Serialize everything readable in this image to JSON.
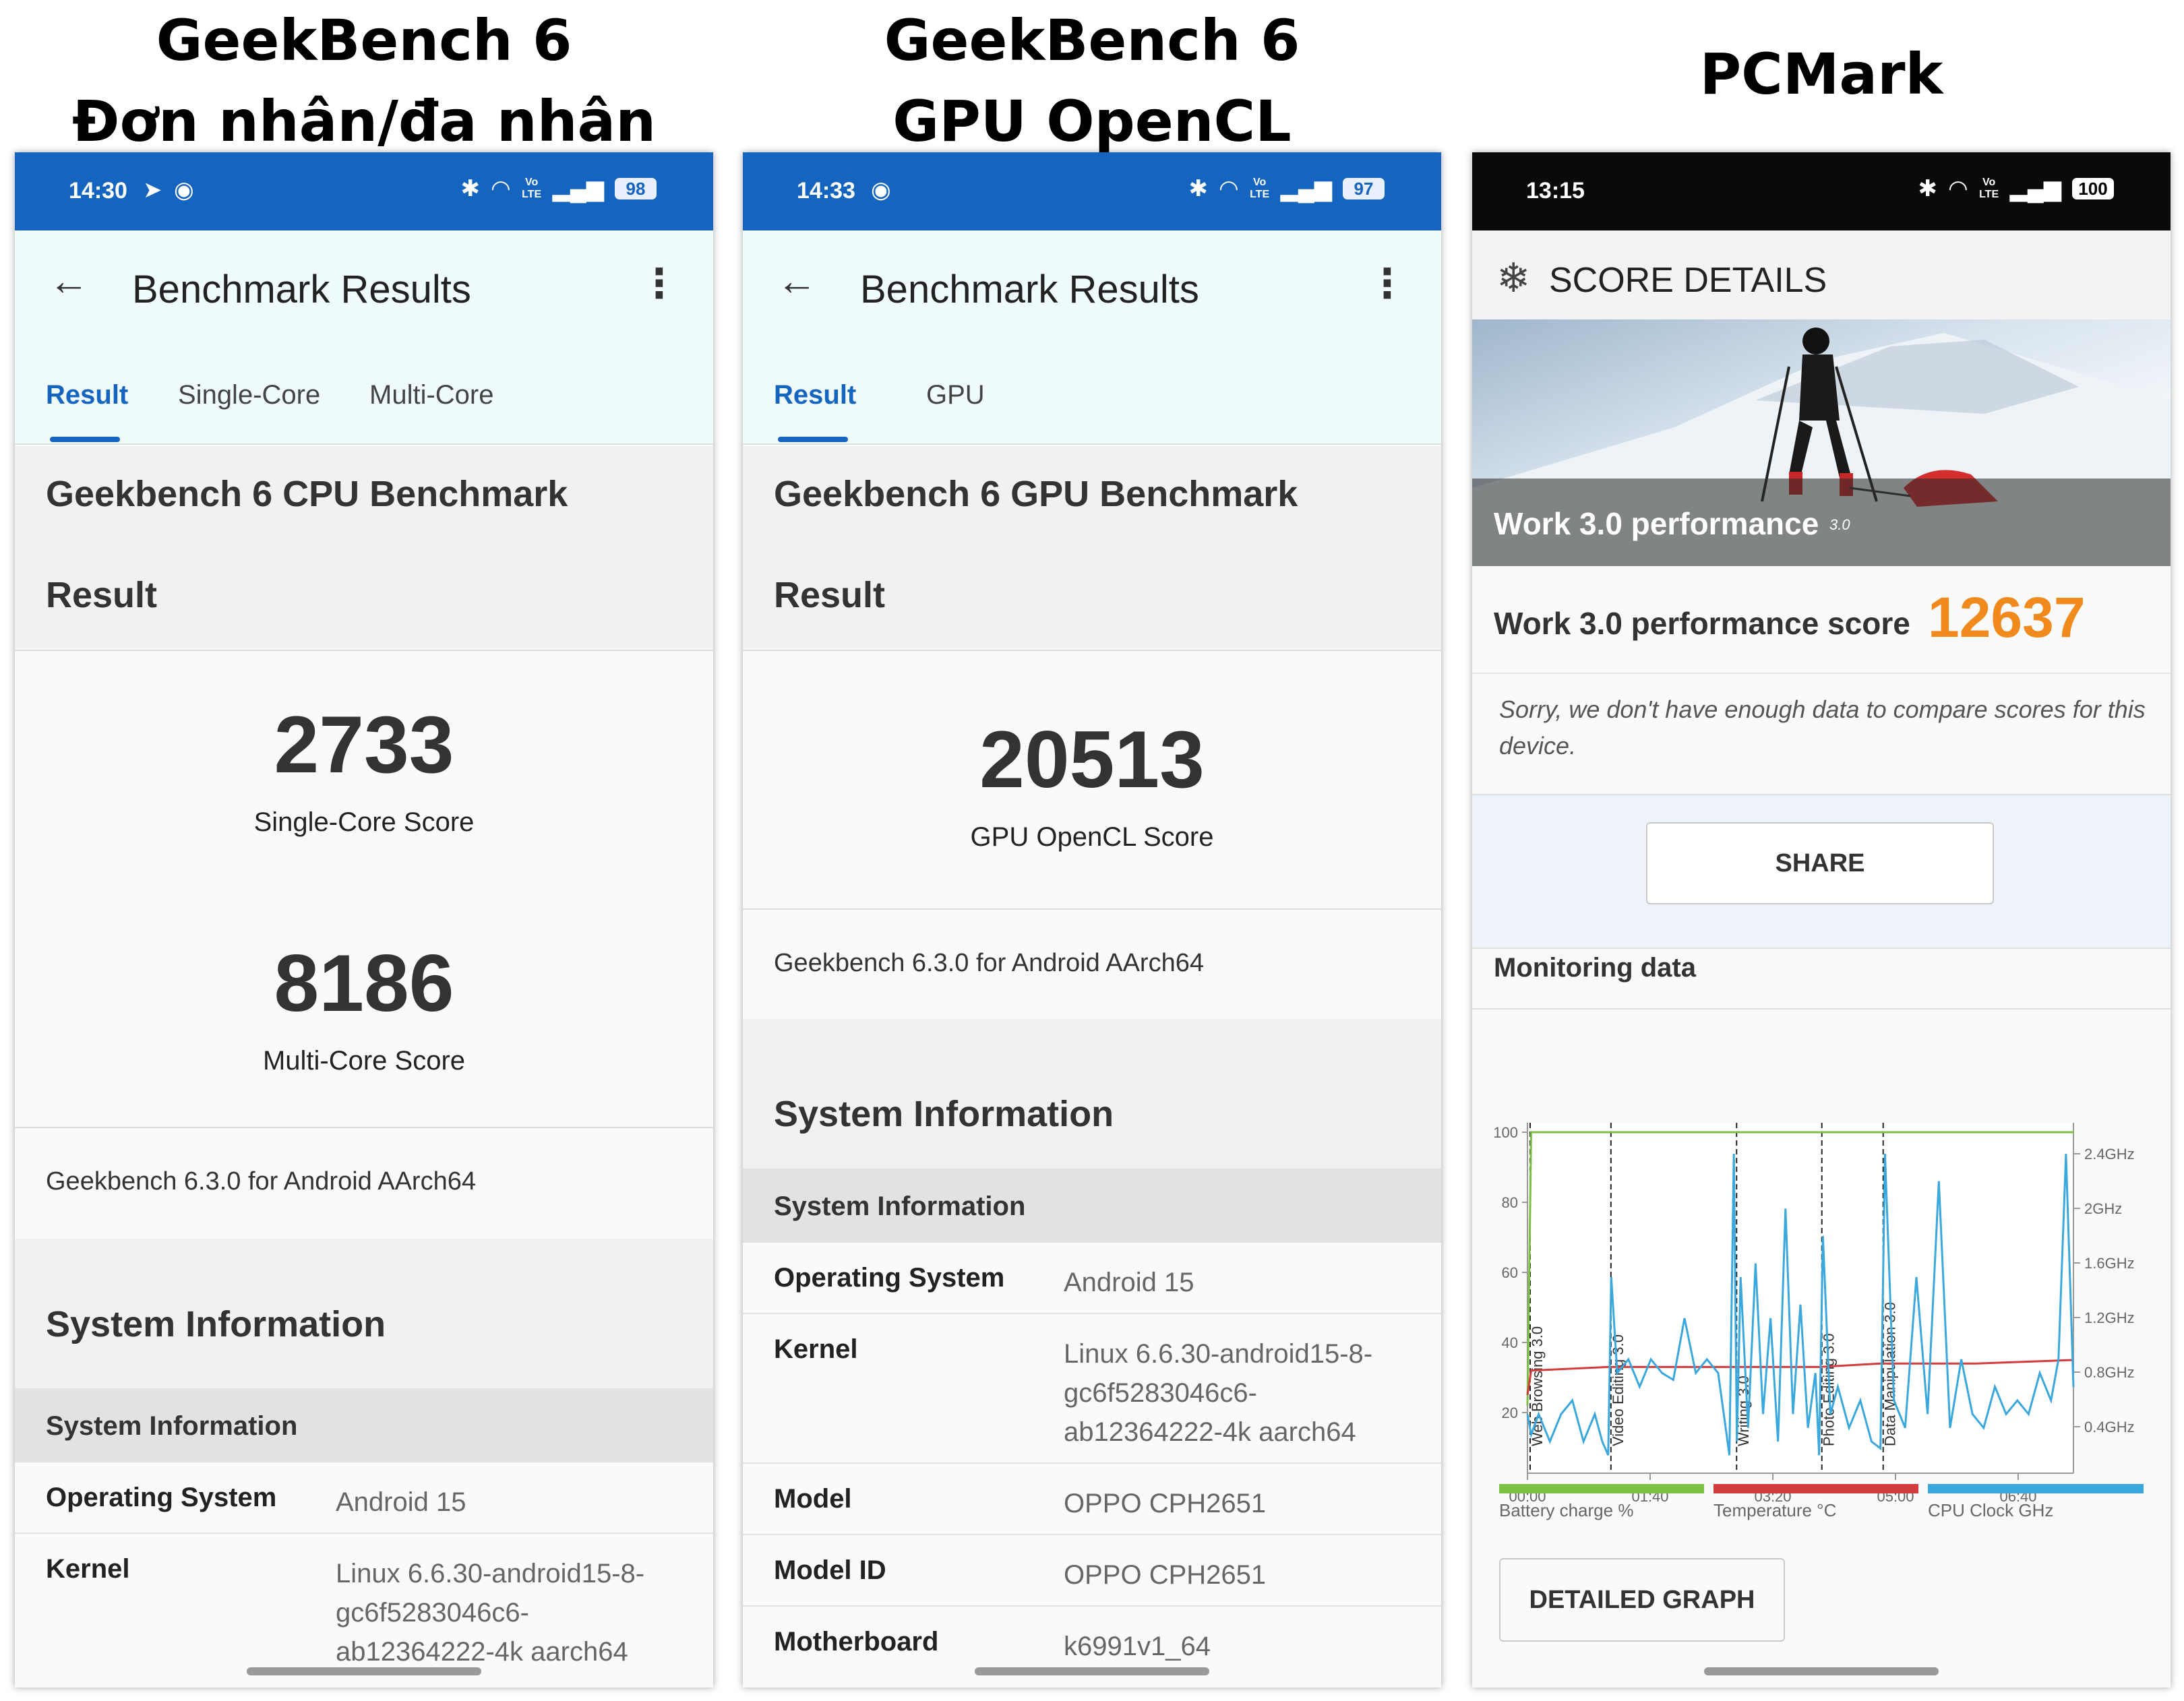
{
  "columns": {
    "col1_title_line1": "GeekBench 6",
    "col1_title_line2": "Đơn nhân/đa nhân",
    "col2_title_line1": "GeekBench 6",
    "col2_title_line2": "GPU OpenCL",
    "col3_title": "PCMark"
  },
  "phone1": {
    "status": {
      "time": "14:30",
      "battery": "98"
    },
    "header": {
      "title": "Benchmark Results",
      "tabs": [
        "Result",
        "Single-Core",
        "Multi-Core"
      ]
    },
    "benchmark_title": "Geekbench 6 CPU Benchmark",
    "result_heading": "Result",
    "single_core_score": "2733",
    "single_core_label": "Single-Core Score",
    "multi_core_score": "8186",
    "multi_core_label": "Multi-Core Score",
    "version": "Geekbench 6.3.0 for Android AArch64",
    "system_info_title": "System Information",
    "system_info_header": "System Information",
    "rows": [
      {
        "key": "Operating System",
        "value": "Android 15"
      },
      {
        "key": "Kernel",
        "value": "Linux 6.6.30-android15-8-gc6f5283046c6-ab12364222-4k aarch64"
      }
    ]
  },
  "phone2": {
    "status": {
      "time": "14:33",
      "battery": "97"
    },
    "header": {
      "title": "Benchmark Results",
      "tabs": [
        "Result",
        "GPU"
      ]
    },
    "benchmark_title": "Geekbench 6 GPU Benchmark",
    "result_heading": "Result",
    "gpu_score": "20513",
    "gpu_label": "GPU OpenCL Score",
    "version": "Geekbench 6.3.0 for Android AArch64",
    "system_info_title": "System Information",
    "system_info_header": "System Information",
    "rows": [
      {
        "key": "Operating System",
        "value": "Android 15"
      },
      {
        "key": "Kernel",
        "value": "Linux 6.6.30-android15-8-gc6f5283046c6-ab12364222-4k aarch64"
      },
      {
        "key": "Model",
        "value": "OPPO CPH2651"
      },
      {
        "key": "Model ID",
        "value": "OPPO CPH2651"
      },
      {
        "key": "Motherboard",
        "value": "k6991v1_64"
      }
    ]
  },
  "phone3": {
    "status": {
      "time": "13:15",
      "battery": "100"
    },
    "header_title": "SCORE DETAILS",
    "hero_label": "Work 3.0 performance",
    "hero_version": "3.0",
    "score_label": "Work 3.0 performance score",
    "score": "12637",
    "sorry_text": "Sorry, we don't have enough data to compare scores for this device.",
    "share_label": "SHARE",
    "monitoring_title": "Monitoring data",
    "detailed_graph_label": "DETAILED GRAPH",
    "legend": [
      {
        "label": "Battery charge %",
        "color": "#7cc043"
      },
      {
        "label": "Temperature °C",
        "color": "#d23c3c"
      },
      {
        "label": "CPU Clock GHz",
        "color": "#3aa8dc"
      }
    ]
  },
  "chart_data": {
    "type": "line",
    "x_ticks": [
      "00:00",
      "01:40",
      "03:20",
      "05:00",
      "06:40"
    ],
    "y_left_ticks": [
      "100",
      "80",
      "60",
      "40",
      "20"
    ],
    "y_right_ticks": [
      "2.4GHz",
      "2GHz",
      "1.6GHz",
      "1.2GHz",
      "0.8GHz",
      "0.4GHz"
    ],
    "ylim_left": [
      0,
      100
    ],
    "xlim_minutes": [
      0,
      7.3
    ],
    "segments": [
      {
        "label": "Web Browsing 3.0",
        "start_min": 0.0
      },
      {
        "label": "Video Editing 3.0",
        "start_min": 1.08
      },
      {
        "label": "Writing 3.0",
        "start_min": 2.76
      },
      {
        "label": "Photo Editing 3.0",
        "start_min": 3.9
      },
      {
        "label": "Data Manipulation 3.0",
        "start_min": 4.72
      }
    ],
    "series": [
      {
        "name": "Battery charge %",
        "color": "#7cc043",
        "x_min": [
          0,
          0.05,
          7.3
        ],
        "values": [
          22,
          100,
          100
        ]
      },
      {
        "name": "Temperature °C",
        "color": "#d23c3c",
        "x_min": [
          0,
          0.05,
          1.08,
          2.76,
          3.9,
          4.72,
          6.0,
          7.3
        ],
        "values": [
          25,
          32,
          33,
          33,
          33,
          34,
          34,
          35
        ]
      },
      {
        "name": "CPU Clock GHz",
        "color": "#3aa8dc",
        "x_min": [
          0.0,
          0.05,
          0.15,
          0.3,
          0.45,
          0.6,
          0.75,
          0.9,
          1.0,
          1.08,
          1.12,
          1.2,
          1.35,
          1.5,
          1.65,
          1.8,
          1.95,
          2.1,
          2.25,
          2.4,
          2.55,
          2.7,
          2.76,
          2.8,
          2.85,
          2.95,
          3.05,
          3.15,
          3.25,
          3.35,
          3.45,
          3.55,
          3.65,
          3.75,
          3.85,
          3.9,
          3.95,
          4.05,
          4.15,
          4.3,
          4.45,
          4.6,
          4.72,
          4.78,
          4.9,
          5.05,
          5.2,
          5.35,
          5.5,
          5.65,
          5.8,
          5.95,
          6.1,
          6.25,
          6.4,
          6.55,
          6.7,
          6.85,
          7.0,
          7.1,
          7.2,
          7.3
        ],
        "values": [
          0.5,
          0.35,
          0.5,
          0.3,
          0.5,
          0.6,
          0.3,
          0.5,
          0.3,
          0.2,
          1.5,
          0.8,
          0.9,
          0.7,
          0.9,
          0.8,
          0.75,
          1.2,
          0.8,
          0.9,
          0.8,
          0.2,
          2.4,
          0.3,
          1.5,
          0.4,
          1.6,
          0.5,
          1.2,
          0.3,
          2.0,
          0.5,
          1.3,
          0.4,
          0.8,
          0.2,
          1.8,
          0.5,
          0.7,
          0.4,
          0.6,
          0.3,
          0.25,
          2.4,
          0.6,
          0.4,
          1.5,
          0.5,
          2.2,
          0.4,
          0.9,
          0.5,
          0.4,
          0.7,
          0.5,
          0.6,
          0.5,
          0.8,
          0.6,
          0.9,
          2.4,
          0.7
        ]
      }
    ]
  }
}
